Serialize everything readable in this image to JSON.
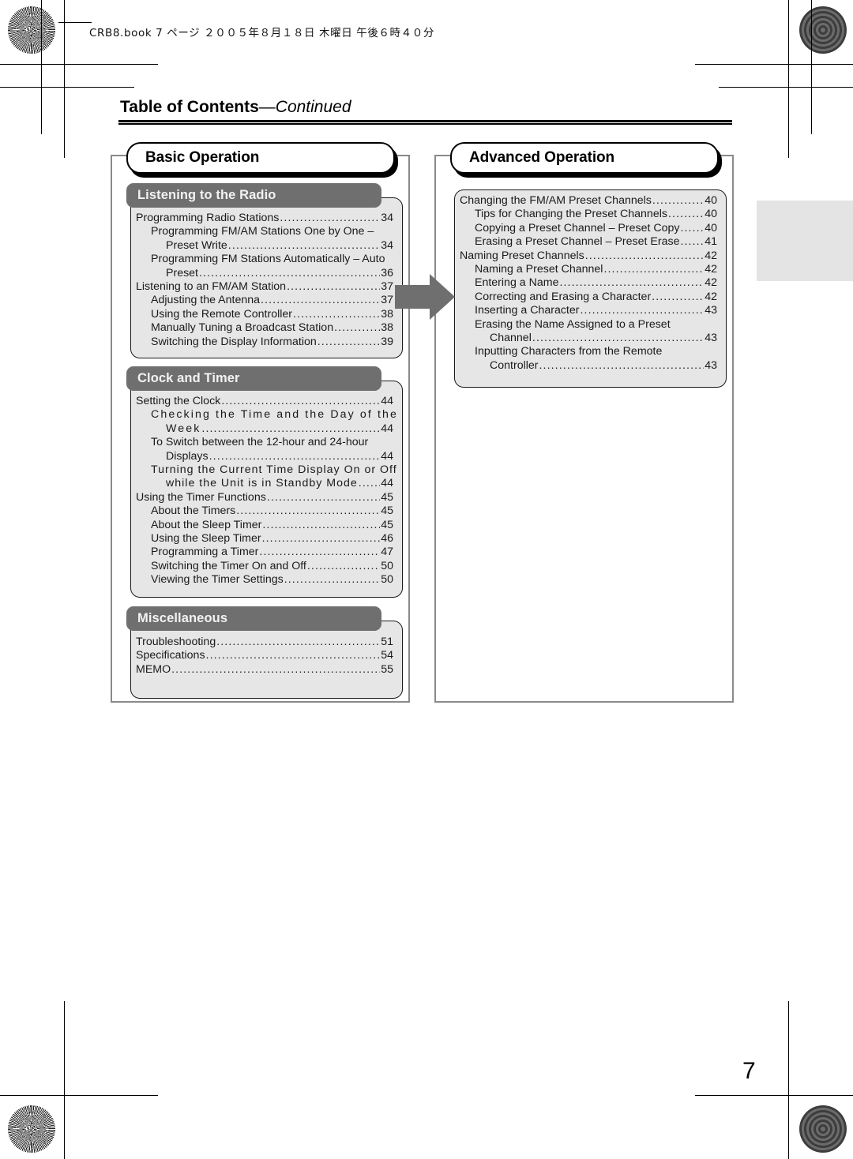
{
  "header": {
    "text": "CRB8.book 7 ページ ２００５年８月１８日 木曜日 午後６時４０分"
  },
  "title": {
    "main": "Table of Contents",
    "dash": "—",
    "continued": "Continued"
  },
  "page_number": "7",
  "colors": {
    "band": "#6f6f6f",
    "body": "#e6e6e6",
    "frame": "#8a8a8a",
    "arrow": "#6f6f6f",
    "side_tab": "#e4e4e4"
  },
  "columns": [
    {
      "name": "basic-operation",
      "heading": "Basic Operation",
      "groups": [
        {
          "name": "listening-to-the-radio",
          "title": "Listening to the Radio",
          "entries": [
            {
              "level": 1,
              "text": "Programming Radio Stations",
              "page": "34",
              "leader": true
            },
            {
              "level": 2,
              "text": "Programming FM/AM Stations One by One –",
              "page": "",
              "leader": false
            },
            {
              "level": 3,
              "text": "Preset Write",
              "page": "34",
              "leader": true
            },
            {
              "level": 2,
              "text": "Programming FM Stations Automatically – Auto",
              "page": "",
              "leader": false
            },
            {
              "level": 3,
              "text": "Preset",
              "page": "36",
              "leader": true
            },
            {
              "level": 1,
              "text": "Listening to an FM/AM Station",
              "page": "37",
              "leader": true
            },
            {
              "level": 2,
              "text": "Adjusting the Antenna",
              "page": "37",
              "leader": true
            },
            {
              "level": 2,
              "text": "Using the Remote Controller",
              "page": "38",
              "leader": true
            },
            {
              "level": 2,
              "text": "Manually Tuning a Broadcast Station",
              "page": "38",
              "leader": true
            },
            {
              "level": 2,
              "text": "Switching the Display Information",
              "page": "39",
              "leader": true
            }
          ]
        },
        {
          "name": "clock-and-timer",
          "title": "Clock and Timer",
          "entries": [
            {
              "level": 1,
              "text": "Setting the Clock",
              "page": "44",
              "leader": true
            },
            {
              "level": 2,
              "text": "Checking the Time and the Day of the",
              "page": "",
              "leader": false,
              "tracking": "wide"
            },
            {
              "level": 3,
              "text": "Week",
              "page": "44",
              "leader": true,
              "tracking": "wide"
            },
            {
              "level": 2,
              "text": "To Switch between the 12-hour and 24-hour",
              "page": "",
              "leader": false
            },
            {
              "level": 3,
              "text": "Displays",
              "page": "44",
              "leader": true
            },
            {
              "level": 2,
              "text": "Turning the Current Time Display On or Off",
              "page": "",
              "leader": false,
              "tracking": "wide2"
            },
            {
              "level": 3,
              "text": "while the Unit is in Standby Mode",
              "page": "44",
              "leader": true,
              "tracking": "wide2"
            },
            {
              "level": 1,
              "text": "Using the Timer Functions",
              "page": "45",
              "leader": true
            },
            {
              "level": 2,
              "text": "About the Timers",
              "page": "45",
              "leader": true
            },
            {
              "level": 2,
              "text": "About the Sleep Timer",
              "page": "45",
              "leader": true
            },
            {
              "level": 2,
              "text": "Using the Sleep Timer",
              "page": "46",
              "leader": true
            },
            {
              "level": 2,
              "text": "Programming a Timer",
              "page": "47",
              "leader": true
            },
            {
              "level": 2,
              "text": "Switching the Timer On and Off",
              "page": "50",
              "leader": true
            },
            {
              "level": 2,
              "text": "Viewing the Timer Settings",
              "page": "50",
              "leader": true
            }
          ]
        },
        {
          "name": "miscellaneous",
          "title": "Miscellaneous",
          "entries": [
            {
              "level": 1,
              "text": "Troubleshooting",
              "page": "51",
              "leader": true
            },
            {
              "level": 1,
              "text": "Specifications",
              "page": "54",
              "leader": true
            },
            {
              "level": 1,
              "text": "MEMO",
              "page": "55",
              "leader": true
            }
          ]
        }
      ]
    },
    {
      "name": "advanced-operation",
      "heading": "Advanced Operation",
      "groups": [
        {
          "name": "advanced-operation-entries",
          "title": "",
          "entries": [
            {
              "level": 1,
              "text": "Changing the FM/AM Preset Channels",
              "page": "40",
              "leader": true
            },
            {
              "level": 2,
              "text": "Tips for Changing the Preset Channels",
              "page": "40",
              "leader": true
            },
            {
              "level": 2,
              "text": "Copying a Preset Channel – Preset Copy",
              "page": "40",
              "leader": true
            },
            {
              "level": 2,
              "text": "Erasing a Preset Channel – Preset Erase",
              "page": "41",
              "leader": true
            },
            {
              "level": 1,
              "text": "Naming Preset Channels",
              "page": "42",
              "leader": true
            },
            {
              "level": 2,
              "text": "Naming a Preset Channel",
              "page": "42",
              "leader": true
            },
            {
              "level": 2,
              "text": "Entering a Name",
              "page": "42",
              "leader": true
            },
            {
              "level": 2,
              "text": "Correcting and Erasing a Character",
              "page": "42",
              "leader": true
            },
            {
              "level": 2,
              "text": "Inserting a Character",
              "page": "43",
              "leader": true
            },
            {
              "level": 2,
              "text": "Erasing the Name Assigned to a Preset",
              "page": "",
              "leader": false
            },
            {
              "level": 3,
              "text": "Channel",
              "page": "43",
              "leader": true
            },
            {
              "level": 2,
              "text": "Inputting Characters from the Remote",
              "page": "",
              "leader": false
            },
            {
              "level": 3,
              "text": "Controller",
              "page": "43",
              "leader": true
            }
          ]
        }
      ]
    }
  ],
  "icons": {
    "arrow": "right-arrow-icon",
    "registration": "registration-mark-icon",
    "starburst": "starburst-mark-icon"
  }
}
